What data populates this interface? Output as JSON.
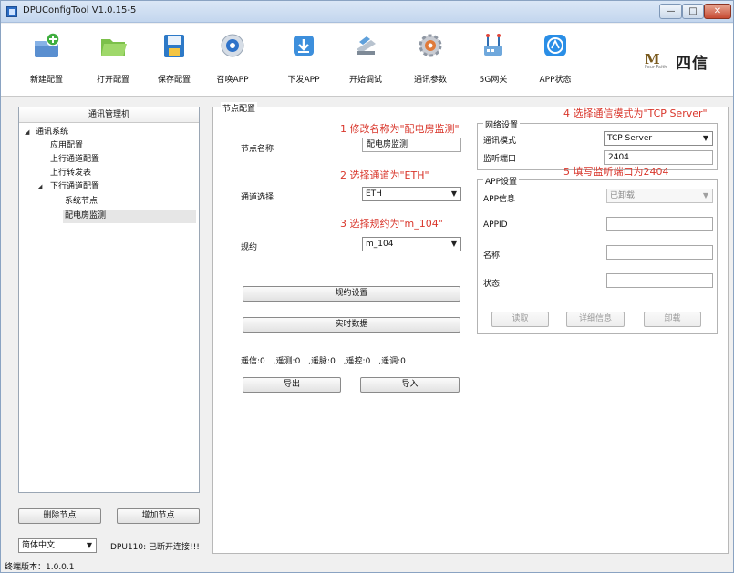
{
  "window": {
    "title": "DPUConfigTool V1.0.15-5",
    "controls": {
      "minimize": "—",
      "maximize": "□",
      "close": "✕"
    }
  },
  "toolbar": [
    {
      "id": "new",
      "label": "新建配置",
      "icon": "new-config-icon"
    },
    {
      "id": "open",
      "label": "打开配置",
      "icon": "open-folder-icon"
    },
    {
      "id": "save",
      "label": "保存配置",
      "icon": "save-disk-icon"
    },
    {
      "id": "summon",
      "label": "召唤APP",
      "icon": "summon-app-icon"
    },
    {
      "id": "deploy",
      "label": "下发APP",
      "icon": "download-icon"
    },
    {
      "id": "debug",
      "label": "开始调试",
      "icon": "debug-icon"
    },
    {
      "id": "params",
      "label": "通讯参数",
      "icon": "gear-icon"
    },
    {
      "id": "gateway",
      "label": "5G网关",
      "icon": "gateway-icon"
    },
    {
      "id": "app_status",
      "label": "APP状态",
      "icon": "app-status-icon"
    }
  ],
  "logo": {
    "mark": "M",
    "sub": "Four-Faith",
    "text": "四信"
  },
  "tree": {
    "header": "通讯管理机",
    "nodes": [
      {
        "label": "通讯系统",
        "arrow": "◢"
      },
      {
        "label": "应用配置"
      },
      {
        "label": "上行通道配置"
      },
      {
        "label": "上行转发表"
      },
      {
        "label": "下行通道配置",
        "arrow": "◢"
      },
      {
        "label": "系统节点"
      },
      {
        "label": "配电房监测"
      }
    ]
  },
  "left_buttons": {
    "delete_node": "删除节点",
    "add_node": "增加节点"
  },
  "language": {
    "value": "简体中文"
  },
  "connection_status": "DPU110: 已断开连接!!!",
  "footer": "终端版本：1.0.0.1",
  "node_config": {
    "title": "节点配置",
    "node_name_label": "节点名称",
    "node_name_value": "配电房监测",
    "channel_label": "通道选择",
    "channel_value": "ETH",
    "protocol_label": "规约",
    "protocol_value": "m_104",
    "protocol_settings_button": "规约设置",
    "realtime_data_button": "实时数据",
    "stats": [
      {
        "label": "遥信:",
        "value": "0"
      },
      {
        "label": ",遥测:",
        "value": "0"
      },
      {
        "label": ",遥脉:",
        "value": "0"
      },
      {
        "label": ",遥控:",
        "value": "0"
      },
      {
        "label": ",遥调:",
        "value": "0"
      }
    ],
    "export_button": "导出",
    "import_button": "导入"
  },
  "network_settings": {
    "title": "网络设置",
    "mode_label": "通讯模式",
    "mode_value": "TCP Server",
    "port_label": "监听端口",
    "port_value": "2404"
  },
  "app_settings": {
    "title": "APP设置",
    "info_label": "APP信息",
    "info_value": "已卸载",
    "appid_label": "APPID",
    "name_label": "名称",
    "status_label": "状态",
    "read_button": "读取",
    "detail_button": "详细信息",
    "uninstall_button": "卸载"
  },
  "annotations": [
    "1 修改名称为\"配电房监测\"",
    "2 选择通道为\"ETH\"",
    "3 选择规约为\"m_104\"",
    "4 选择通信模式为\"TCP Server\"",
    "5 填写监听端口为2404"
  ]
}
